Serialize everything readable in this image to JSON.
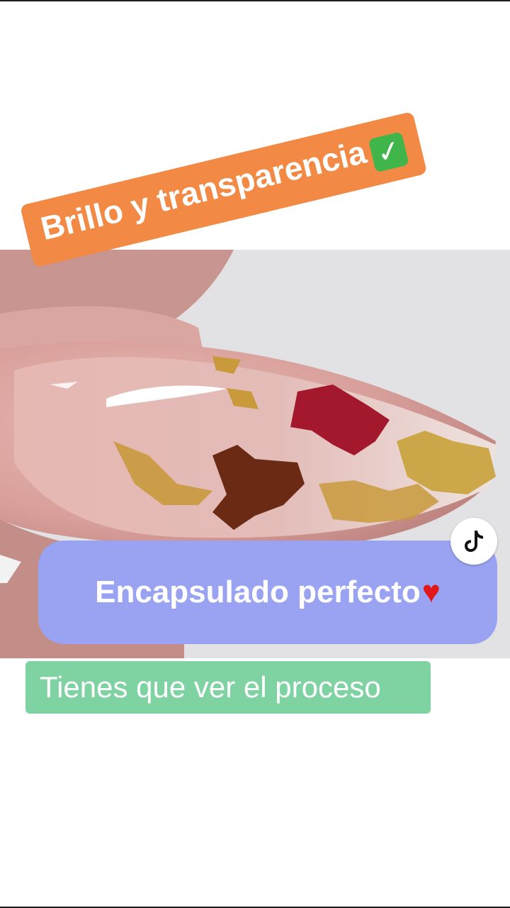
{
  "captions": {
    "top": "Brillo y transparencia",
    "middle": "Encapsulado perfecto",
    "bottom": "Tienes que ver el proceso"
  },
  "icons": {
    "check": "check-mark-button-emoji",
    "heart": "red-heart-emoji",
    "tiktok": "tiktok-logo"
  },
  "colors": {
    "top_caption_bg": "#f28a45",
    "middle_caption_bg": "#9aa3f2",
    "bottom_caption_bg": "#7fd3a3"
  }
}
